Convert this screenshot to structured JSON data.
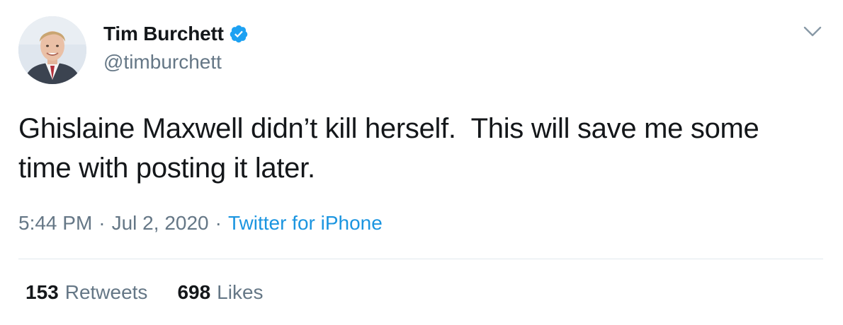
{
  "author": {
    "display_name": "Tim Burchett",
    "handle": "@timburchett",
    "verified_icon": "verified-badge-icon",
    "avatar_icon": "profile-photo"
  },
  "menu": {
    "icon": "chevron-down-icon"
  },
  "tweet": {
    "text": "Ghislaine Maxwell didn’t kill herself.  This will save me some time with posting it later."
  },
  "meta": {
    "time": "5:44 PM",
    "separator": "·",
    "date": "Jul 2, 2020",
    "source": "Twitter for iPhone"
  },
  "stats": {
    "retweets_count": "153",
    "retweets_label": "Retweets",
    "likes_count": "698",
    "likes_label": "Likes"
  },
  "colors": {
    "text_primary": "#14171a",
    "text_secondary": "#657786",
    "link": "#1b95e0",
    "verified": "#1da1f2",
    "divider": "#e1e8ed"
  }
}
